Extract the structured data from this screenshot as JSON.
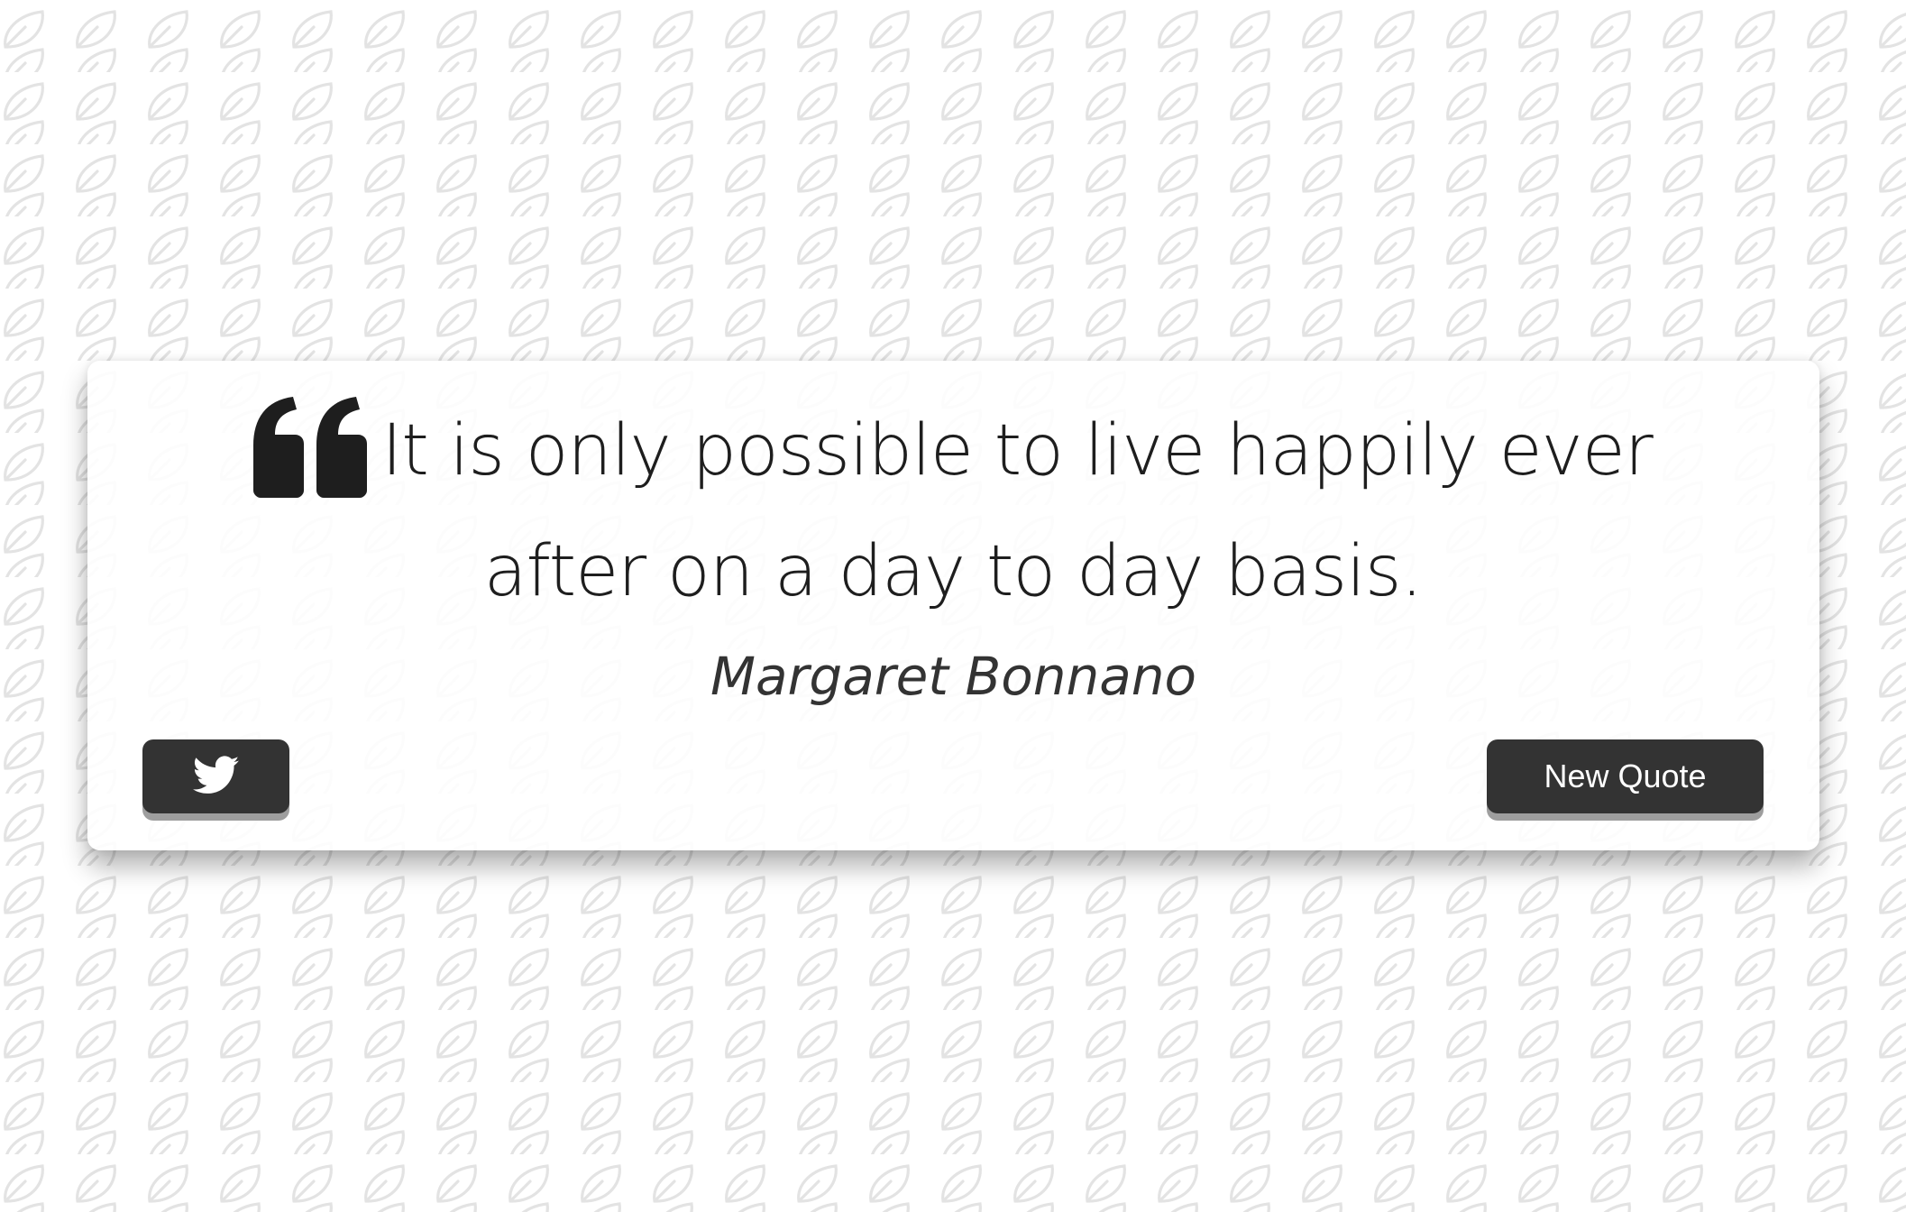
{
  "quote": {
    "text": "It is only possible to live happily ever after on a day to day basis.",
    "author": "Margaret Bonnano"
  },
  "buttons": {
    "tweet_icon": "twitter-icon",
    "new_quote_label": "New Quote"
  },
  "icons": {
    "quote_mark": "quote-left-icon",
    "background_pattern": "leaf-icon"
  },
  "colors": {
    "text": "#1e1e1e",
    "button_bg": "#333333",
    "button_text": "#ffffff",
    "button_shadow": "#9e9e9e",
    "card_bg": "#ffffff",
    "pattern_stroke": "#e3e3e3"
  }
}
